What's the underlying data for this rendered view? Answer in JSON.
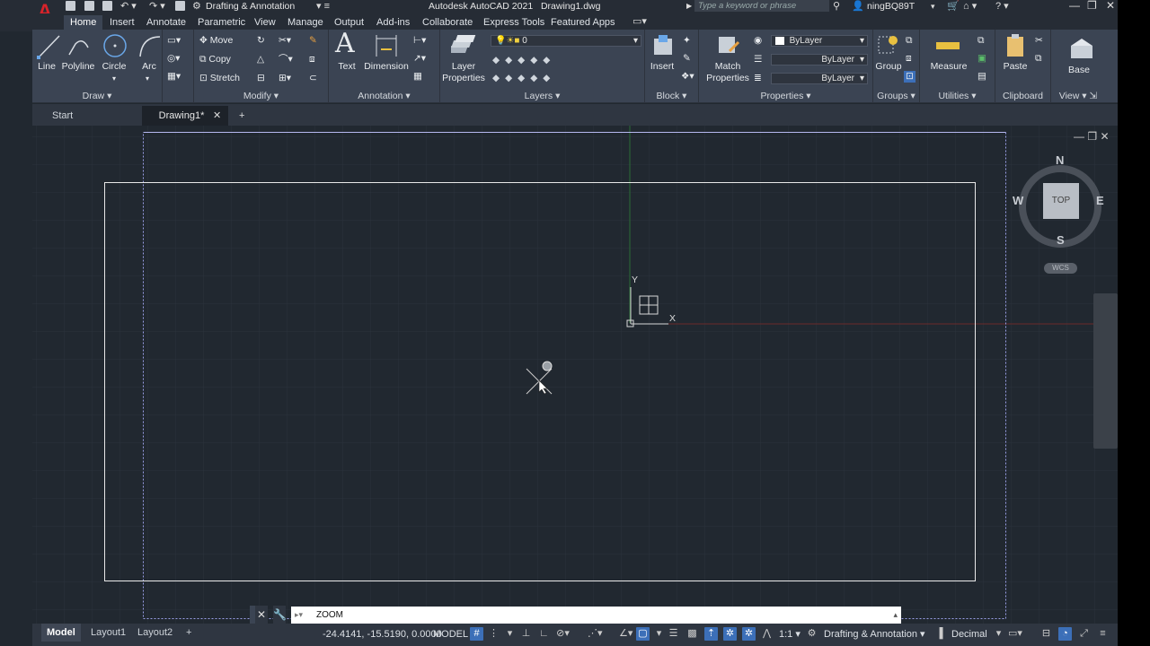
{
  "app": {
    "title": "Autodesk AutoCAD 2021",
    "document": "Drawing1.dwg",
    "workspace": "Drafting & Annotation",
    "logo_letter": "A"
  },
  "search": {
    "placeholder": "Type a keyword or phrase"
  },
  "user": {
    "name": "ningBQ89T"
  },
  "ribbon_tabs": [
    "Home",
    "Insert",
    "Annotate",
    "Parametric",
    "View",
    "Manage",
    "Output",
    "Add-ins",
    "Collaborate",
    "Express Tools",
    "Featured Apps"
  ],
  "draw": {
    "line": "Line",
    "polyline": "Polyline",
    "circle": "Circle",
    "arc": "Arc",
    "panel": "Draw"
  },
  "modify": {
    "move": "Move",
    "copy": "Copy",
    "stretch": "Stretch",
    "panel": "Modify"
  },
  "annotation": {
    "text": "Text",
    "dimension": "Dimension",
    "panel": "Annotation"
  },
  "layers": {
    "layer_properties_line1": "Layer",
    "layer_properties_line2": "Properties",
    "current_layer": "0",
    "panel": "Layers"
  },
  "block": {
    "insert": "Insert",
    "panel": "Block"
  },
  "properties": {
    "match_line1": "Match",
    "match_line2": "Properties",
    "color": "ByLayer",
    "linetype": "ByLayer",
    "lineweight": "ByLayer",
    "panel": "Properties"
  },
  "groups": {
    "group": "Group",
    "panel": "Groups"
  },
  "utilities": {
    "measure": "Measure",
    "panel": "Utilities"
  },
  "clipboard": {
    "paste": "Paste",
    "panel": "Clipboard"
  },
  "view": {
    "base": "Base",
    "panel": "View"
  },
  "doc_tabs": {
    "start": "Start",
    "drawing": "Drawing1*"
  },
  "viewcube": {
    "north": "N",
    "south": "S",
    "east": "E",
    "west": "W",
    "face": "TOP",
    "wcs": "WCS"
  },
  "ucs": {
    "x": "X",
    "y": "Y"
  },
  "command": {
    "value": "ZOOM"
  },
  "status": {
    "model_tab": "Model",
    "layout1": "Layout1",
    "layout2": "Layout2",
    "coords": "-24.4141, -15.5190, 0.0000",
    "mode": "MODEL",
    "scale": "1:1",
    "workspace": "Drafting & Annotation",
    "units": "Decimal"
  },
  "colors": {
    "accent": "#3c6fb8",
    "background": "#212830",
    "ribbon": "#3b4453",
    "logo": "#d8232a"
  }
}
